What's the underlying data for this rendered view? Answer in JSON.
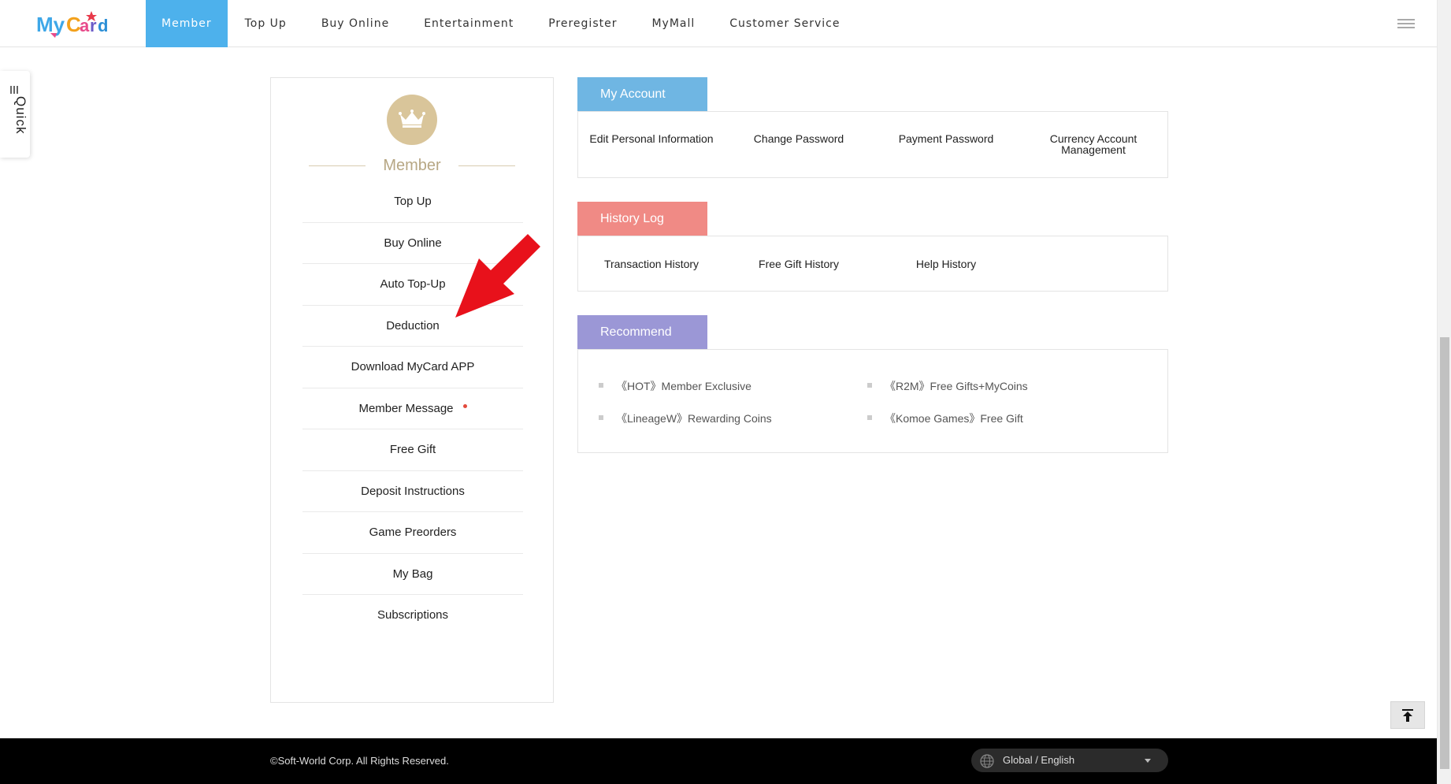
{
  "header": {
    "logo_text": "MyCard",
    "nav": [
      {
        "label": "Member",
        "active": true
      },
      {
        "label": "Top Up"
      },
      {
        "label": "Buy Online"
      },
      {
        "label": "Entertainment"
      },
      {
        "label": "Preregister"
      },
      {
        "label": "MyMall"
      },
      {
        "label": "Customer Service"
      }
    ],
    "accent_color": "#4db1ec"
  },
  "quick_tab": {
    "label": "Quick"
  },
  "sidebar": {
    "title": "Member",
    "icon": "crown-icon",
    "items": [
      {
        "label": "Top Up"
      },
      {
        "label": "Buy Online"
      },
      {
        "label": "Auto Top-Up"
      },
      {
        "label": "Deduction"
      },
      {
        "label": "Download MyCard APP"
      },
      {
        "label": "Member Message",
        "has_notification": true
      },
      {
        "label": "Free Gift"
      },
      {
        "label": "Deposit Instructions"
      },
      {
        "label": "Game Preorders"
      },
      {
        "label": "My Bag"
      },
      {
        "label": "Subscriptions"
      }
    ]
  },
  "my_account": {
    "title": "My Account",
    "color": "#6fb6e3",
    "items": [
      {
        "label": "Edit Personal Information"
      },
      {
        "label": "Change Password"
      },
      {
        "label": "Payment Password"
      },
      {
        "label": "Currency Account Management"
      }
    ]
  },
  "history_log": {
    "title": "History Log",
    "color": "#f08a85",
    "items": [
      {
        "label": "Transaction History"
      },
      {
        "label": "Free Gift History"
      },
      {
        "label": "Help History"
      }
    ]
  },
  "recommend": {
    "title": "Recommend",
    "color": "#9b97d6",
    "items": [
      {
        "label": "《HOT》Member Exclusive"
      },
      {
        "label": "《R2M》Free Gifts+MyCoins"
      },
      {
        "label": "《LineageW》Rewarding Coins"
      },
      {
        "label": "《Komoe Games》Free Gift"
      }
    ]
  },
  "footer": {
    "copyright": "©Soft-World Corp. All Rights Reserved.",
    "language": "Global / English"
  },
  "annotation": {
    "color": "#e8111b"
  }
}
